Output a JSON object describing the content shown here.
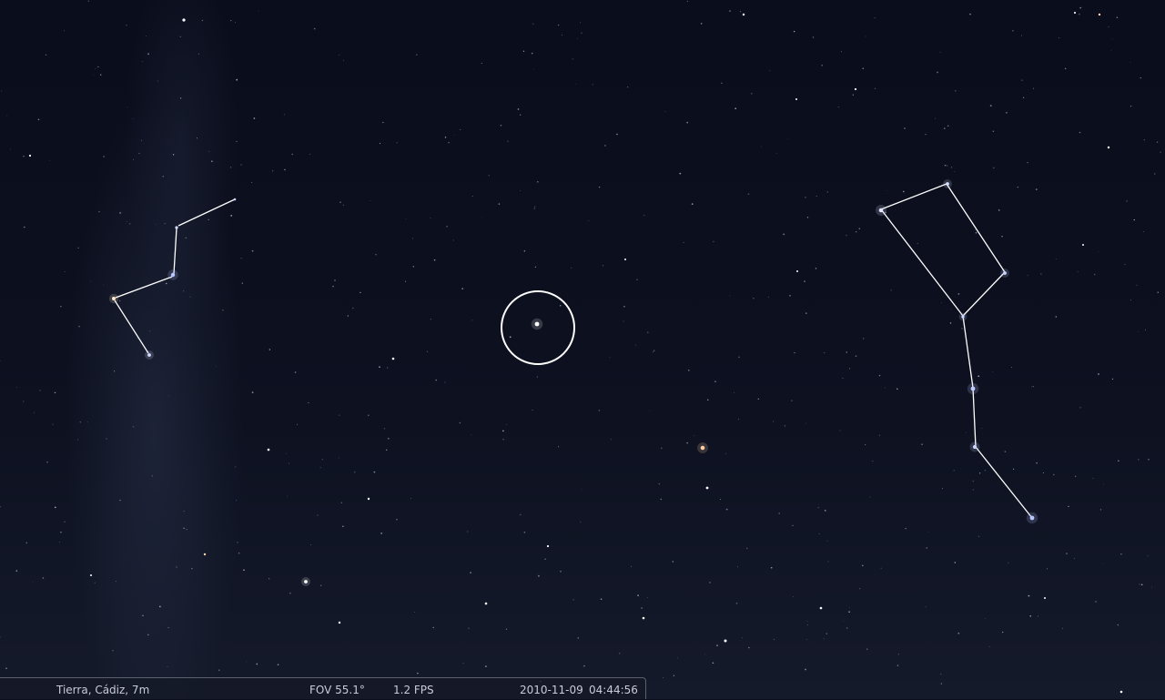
{
  "status_bar": {
    "location": "Tierra, Cádiz, 7m",
    "fov": "FOV 55.1°",
    "fps": "1.2 FPS",
    "date": "2010-11-09",
    "time": "04:44:56"
  },
  "colors": {
    "sky": "#0b0e1c",
    "constellation_line": "#ffffff",
    "selection_marker": "#ffffff",
    "status_text": "#c9ccd6"
  }
}
